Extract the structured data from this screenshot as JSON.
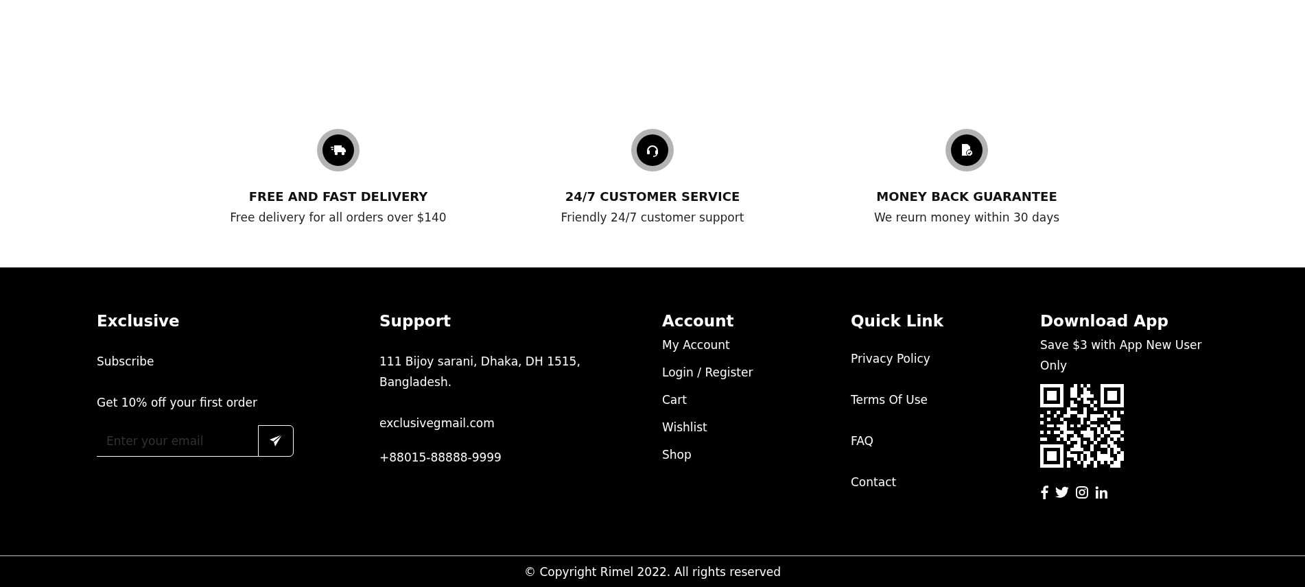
{
  "features": [
    {
      "title": "FREE AND FAST DELIVERY",
      "description": "Free delivery for all orders over $140"
    },
    {
      "title": "24/7 CUSTOMER SERVICE",
      "description": "Friendly 24/7 customer support"
    },
    {
      "title": "MONEY BACK GUARANTEE",
      "description": "We reurn money within 30 days"
    }
  ],
  "footer": {
    "exclusive": {
      "title": "Exclusive",
      "subscribe": "Subscribe",
      "offer": "Get 10% off your first order",
      "email_field": {
        "placeholder": "Enter your email"
      }
    },
    "support": {
      "title": "Support",
      "address": "111 Bijoy sarani, Dhaka, DH 1515, Bangladesh.",
      "email": "exclusivegmail.com",
      "phone": "+88015-88888-9999"
    },
    "account": {
      "title": "Account",
      "links": [
        "My Account",
        "Login / Register",
        "Cart",
        "Wishlist",
        "Shop"
      ]
    },
    "quick_link": {
      "title": "Quick Link",
      "links": [
        "Privacy Policy",
        "Terms Of Use",
        "FAQ",
        "Contact"
      ]
    },
    "download_app": {
      "title": "Download App",
      "text": "Save $3 with App New User Only"
    }
  },
  "copyright": "© Copyright Rimel 2022. All rights reserved"
}
